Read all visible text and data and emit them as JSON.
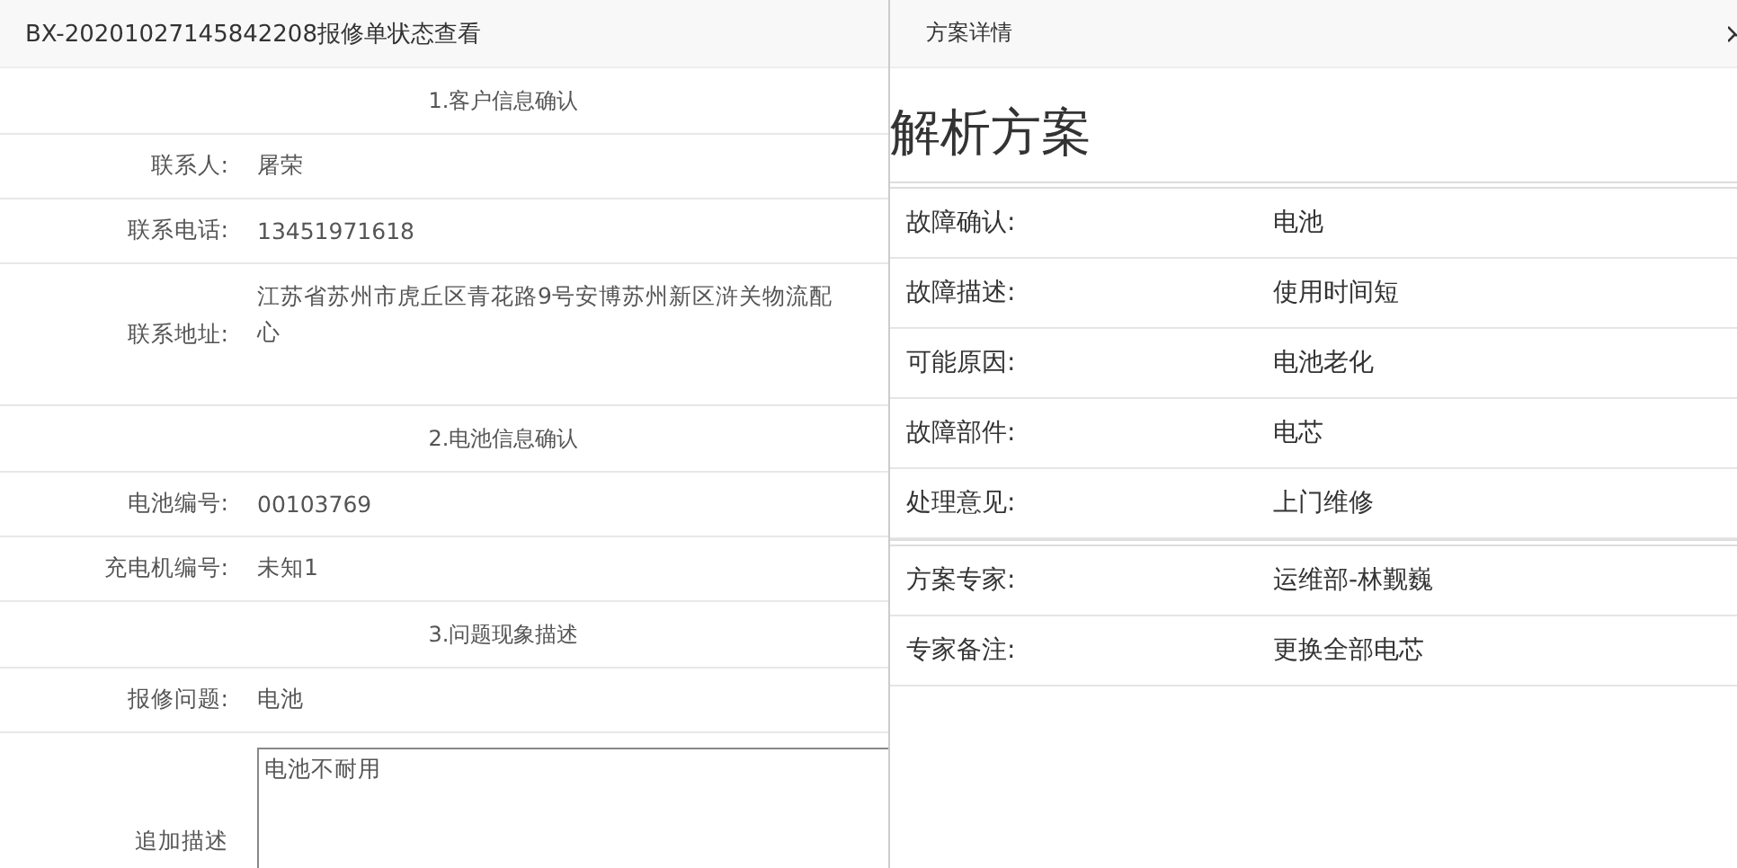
{
  "left_panel": {
    "title": "BX-20201027145842208报修单状态查看",
    "rows": [
      {
        "kind": "section",
        "text": "1.客户信息确认"
      },
      {
        "kind": "field",
        "label": "联系人:",
        "lines": [
          "屠荣"
        ]
      },
      {
        "kind": "field",
        "label": "联系电话:",
        "lines": [
          "13451971618"
        ]
      },
      {
        "kind": "field",
        "label": "联系地址:",
        "lines": [
          "江苏省苏州市虎丘区青花路9号安博苏州新区浒关物流配",
          "心"
        ]
      },
      {
        "kind": "section",
        "text": "2.电池信息确认"
      },
      {
        "kind": "field",
        "label": "电池编号:",
        "lines": [
          "00103769"
        ]
      },
      {
        "kind": "field",
        "label": "充电机编号:",
        "lines": [
          "未知1"
        ]
      },
      {
        "kind": "section",
        "text": "3.问题现象描述"
      },
      {
        "kind": "field",
        "label": "报修问题:",
        "lines": [
          "电池"
        ]
      },
      {
        "kind": "textarea",
        "label": "追加描述",
        "value": "电池不耐用"
      }
    ]
  },
  "right_panel": {
    "title": "方案详情",
    "heading": "解析方案",
    "groups": [
      [
        {
          "label": "故障确认:",
          "value": "电池"
        },
        {
          "label": "故障描述:",
          "value": "使用时间短"
        },
        {
          "label": "可能原因:",
          "value": "电池老化"
        },
        {
          "label": "故障部件:",
          "value": "电芯"
        },
        {
          "label": "处理意见:",
          "value": "上门维修"
        }
      ],
      [
        {
          "label": "方案专家:",
          "value": "运维部-林觐巍"
        },
        {
          "label": "专家备注:",
          "value": "更换全部电芯"
        }
      ]
    ]
  }
}
